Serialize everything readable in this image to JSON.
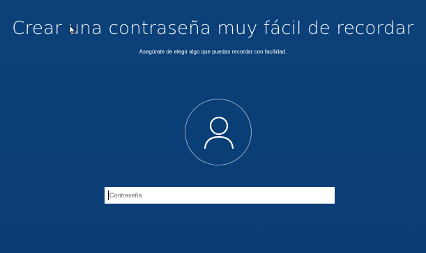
{
  "header": {
    "title": "Crear una contraseña muy fácil de recordar",
    "subtitle": "Asegúrate de elegir algo que puedas recordar con facilidad."
  },
  "avatar": {
    "icon": "user-icon"
  },
  "password": {
    "placeholder": "Contraseña",
    "value": ""
  },
  "colors": {
    "background": "#0a3e73",
    "text": "#ffffff",
    "field": "#ffffff"
  }
}
